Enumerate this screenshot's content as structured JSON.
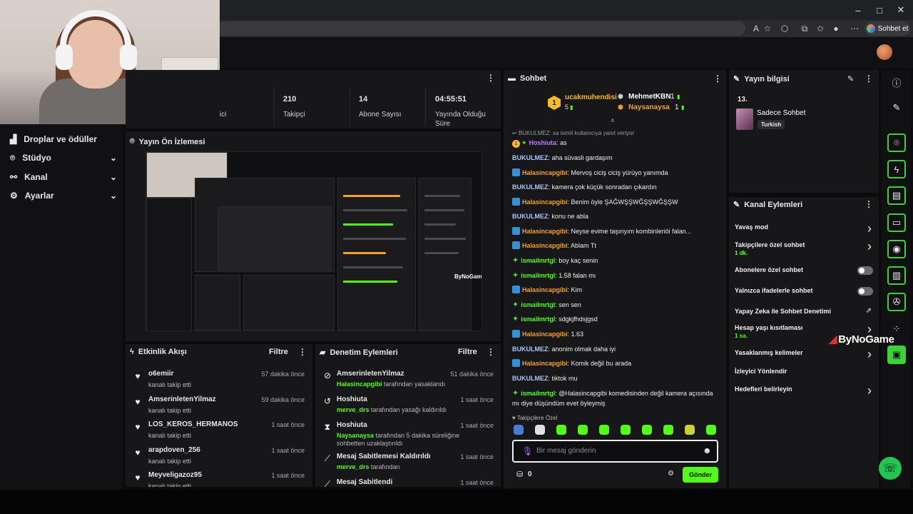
{
  "browser": {
    "copilot_label": "Sohbet et",
    "window_minimize": "–",
    "window_maximize": "□",
    "window_close": "✕"
  },
  "sidebar": {
    "items": [
      {
        "label": "Droplar ve ödüller",
        "icon": "drops-icon"
      },
      {
        "label": "Stüdyo",
        "icon": "studio-icon"
      },
      {
        "label": "Kanal",
        "icon": "channel-icon"
      },
      {
        "label": "Ayarlar",
        "icon": "gear-icon"
      }
    ]
  },
  "stats": {
    "cut_label": "ici",
    "items": [
      {
        "value": "210",
        "label": "Takipçi"
      },
      {
        "value": "14",
        "label": "Abone Sayısı"
      },
      {
        "value": "04:55:51",
        "label": "Yayında Olduğu Süre"
      }
    ]
  },
  "preview": {
    "title": "Yayın Ön İzlemesi",
    "overlay_text": "ByNoGame"
  },
  "feed": {
    "title": "Etkinlik Akışı",
    "filter": "Filtre",
    "items": [
      {
        "name": "o6emiir",
        "action": "kanalı takip etti",
        "time": "57 dakika önce"
      },
      {
        "name": "AmserinletenYilmaz",
        "action": "kanalı takip etti",
        "time": "59 dakika önce"
      },
      {
        "name": "LOS_KEROS_HERMANOS",
        "action": "kanalı takip etti",
        "time": "1 saat önce"
      },
      {
        "name": "arapdoven_256",
        "action": "kanalı takip etti",
        "time": "1 saat önce"
      },
      {
        "name": "Meyveligazoz95",
        "action": "kanalı takip etti",
        "time": "1 saat önce"
      }
    ]
  },
  "modlog": {
    "title": "Denetim Eylemleri",
    "filter": "Filtre",
    "items": [
      {
        "name": "AmserinletenYilmaz",
        "actor": "Halasincapgibi",
        "action": " tarafından yasaklandı",
        "time": "51 dakika önce",
        "icon": "ban-icon"
      },
      {
        "name": "Hoshiuta",
        "actor": "merve_drs",
        "action": " tarafından yasağı kaldırıldı",
        "time": "1 saat önce",
        "icon": "unban-icon"
      },
      {
        "name": "Hoshiuta",
        "actor": "Naysanaysa",
        "action": " tarafından 5 dakika süreliğine sohbetten uzaklaştırıldı",
        "time": "1 saat önce",
        "icon": "hourglass-icon"
      },
      {
        "name": "Mesaj Sabitlemesi Kaldırıldı",
        "actor": "merve_drs",
        "action": " tarafından",
        "time": "1 saat önce",
        "icon": "unpin-icon"
      },
      {
        "name": "Mesaj Sabitlendi",
        "actor": "",
        "action": "",
        "time": "1 saat önce",
        "icon": "pin-icon"
      }
    ]
  },
  "chat": {
    "title": "Sohbet",
    "top_gifter": {
      "rank": "1",
      "name": "ucakmuhendisi",
      "count": "5"
    },
    "gifters": [
      {
        "name": "MehmetKBN",
        "count": "1"
      },
      {
        "name": "Naysanaysa",
        "count": "1"
      }
    ],
    "reply_note": "BUKULMEZ: sa isimli kullanıcıya yanıt veriyor",
    "messages": [
      {
        "user": "Hoshiuta",
        "text": ": as",
        "color": "#c07bff",
        "badge": "gifter"
      },
      {
        "user": "BUKULMEZ",
        "text": ": aha süvasli gardaşım",
        "color": "#a9c6f5",
        "badge": ""
      },
      {
        "user": "Halasincapgibi",
        "text": ": Mervoş ciciş ciciş yürüyo yanımda",
        "color": "#f5a02a",
        "badge": "blue"
      },
      {
        "user": "BUKULMEZ",
        "text": ": kamera çok küçük sonradan çıkardın",
        "color": "#a9c6f5",
        "badge": ""
      },
      {
        "user": "Halasincapgibi",
        "text": ": Benim öyle ŞAĞWŞŞWĞŞŞWĞŞŞW",
        "color": "#f5a02a",
        "badge": "blue"
      },
      {
        "user": "BUKULMEZ",
        "text": ": konu ne abla",
        "color": "#a9c6f5",
        "badge": ""
      },
      {
        "user": "Halasincapgibi",
        "text": ": Neyse evime taşınyım kombinleriöi falan...",
        "color": "#f5a02a",
        "badge": "blue"
      },
      {
        "user": "Halasincapgibi",
        "text": ": Ablam Tt",
        "color": "#f5a02a",
        "badge": "blue"
      },
      {
        "user": "ismailmrtgl",
        "text": ": boy kaç senin",
        "color": "#53fc18",
        "badge": "green"
      },
      {
        "user": "ismailmrtgl",
        "text": ": 1.58 falan mı",
        "color": "#53fc18",
        "badge": "green"
      },
      {
        "user": "Halasincapgibi",
        "text": ": Kim",
        "color": "#f5a02a",
        "badge": "blue"
      },
      {
        "user": "ismailmrtgl",
        "text": ": sen sen",
        "color": "#53fc18",
        "badge": "green"
      },
      {
        "user": "ismailmrtgl",
        "text": ": sdgkjfhdsjgsd",
        "color": "#53fc18",
        "badge": "green"
      },
      {
        "user": "Halasincapgibi",
        "text": ": 1.63",
        "color": "#f5a02a",
        "badge": "blue"
      },
      {
        "user": "BUKULMEZ",
        "text": ": anonim olmak daha iyi",
        "color": "#a9c6f5",
        "badge": ""
      },
      {
        "user": "Halasincapgibi",
        "text": ": Komik değil bu arada",
        "color": "#f5a02a",
        "badge": "blue"
      },
      {
        "user": "BUKULMEZ",
        "text": ": tiktok mu",
        "color": "#a9c6f5",
        "badge": ""
      },
      {
        "user": "ismailmrtgl",
        "text": ": @Halasincapgibi komedisinden değil kamera açısında mı diye düşündüm evet öyleymiş",
        "color": "#53fc18",
        "badge": "green"
      }
    ],
    "followers_only_label": "Takipçilere Özel",
    "input_placeholder": "Bir mesaj gönderin",
    "points": "0",
    "send_label": "Gönder"
  },
  "stream_info": {
    "title": "Yayın bilgisi",
    "number": "13.",
    "stream_title": "Sadece Sohbet",
    "language": "Turkish"
  },
  "channel_actions": {
    "title": "Kanal Eylemleri",
    "items": [
      {
        "label": "Yavaş mod",
        "sub": "",
        "control": "chevron"
      },
      {
        "label": "Takipçilere özel sohbet",
        "sub": "1 dk.",
        "control": "chevron"
      },
      {
        "label": "Abonelere özel sohbet",
        "sub": "",
        "control": "toggle"
      },
      {
        "label": "Yalnızca ifadelerle sohbet",
        "sub": "",
        "control": "toggle"
      },
      {
        "label": "Yapay Zeka ile Sohbet Denetimi",
        "sub": "",
        "control": "external"
      },
      {
        "label": "Hesap yaşı kısıtlaması",
        "sub": "1 sa.",
        "control": "chevron"
      },
      {
        "label": "Yasaklanmış kelimeler",
        "sub": "",
        "control": "chevron"
      },
      {
        "label": "İzleyici Yönlendir",
        "sub": "",
        "control": "none"
      },
      {
        "label": "Hedefleri belirleyin",
        "sub": "",
        "control": "chevron"
      }
    ]
  },
  "watermark": "ByNoGame",
  "colors": {
    "accent": "#53fc18",
    "panel": "#17171a",
    "background": "#0b0b0d"
  }
}
